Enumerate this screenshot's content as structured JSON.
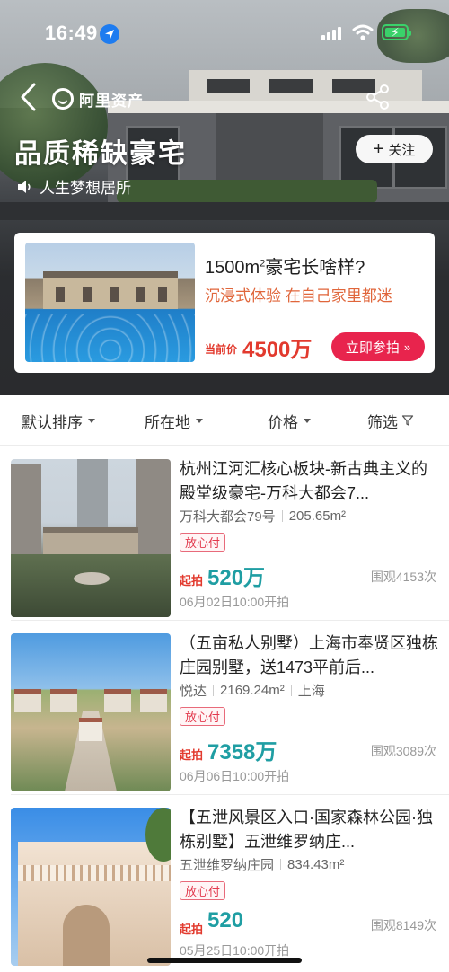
{
  "status_bar": {
    "time": "16:49"
  },
  "header": {
    "logo_text": "阿里资产",
    "title": "品质稀缺豪宅",
    "subtitle": "人生梦想居所",
    "follow_label": "关注"
  },
  "banner": {
    "title_pre": "1500m",
    "title_sup": "2",
    "title_post": "豪宅长啥样?",
    "desc": "沉浸式体验 在自己家里都迷",
    "price_label": "当前价",
    "price": "4500万",
    "button_label": "立即参拍",
    "button_chevron": "»"
  },
  "filters": [
    {
      "label": "默认排序"
    },
    {
      "label": "所在地"
    },
    {
      "label": "价格"
    },
    {
      "label": "筛选"
    }
  ],
  "listings": [
    {
      "title": "杭州江河汇核心板块-新古典主义的殿堂级豪宅-万科大都会7...",
      "community": "万科大都会79号",
      "area": "205.65m²",
      "city": "",
      "tag": "放心付",
      "price_label": "起拍",
      "price": "520万",
      "views": "围观4153次",
      "time": "06月02日10:00开拍"
    },
    {
      "title": "（五亩私人别墅）上海市奉贤区独栋庄园别墅，送1473平前后...",
      "community": "悦达",
      "area": "2169.24m²",
      "city": "上海",
      "tag": "放心付",
      "price_label": "起拍",
      "price": "7358万",
      "views": "围观3089次",
      "time": "06月06日10:00开拍"
    },
    {
      "title": "【五泄风景区入口·国家森林公园·独栋别墅】五泄维罗纳庄...",
      "community": "五泄维罗纳庄园",
      "area": "834.43m²",
      "city": "",
      "tag": "放心付",
      "price_label": "起拍",
      "price": "520",
      "views": "围观8149次",
      "time": "05月25日10:00开拍"
    }
  ],
  "colors": {
    "accent_red": "#e8244d",
    "price_teal": "#1f9ea3",
    "orange_text": "#e0663b"
  }
}
